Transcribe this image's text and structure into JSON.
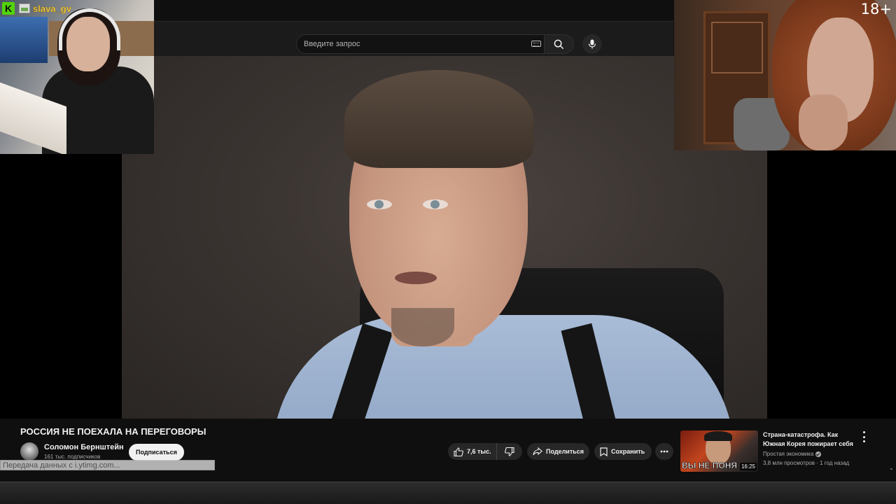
{
  "search": {
    "placeholder": "Введите запрос"
  },
  "video": {
    "title": "РОССИЯ НЕ ПОЕХАЛА НА ПЕРЕГОВОРЫ",
    "channel_name": "Соломон Бернштейн",
    "subscribers": "161 тыс. подписчиков",
    "subscribe_label": "Подписаться",
    "likes": "7,6 тыс.",
    "share_label": "Поделиться",
    "save_label": "Сохранить"
  },
  "status_bar": {
    "text": "Передача данных с i.ytimg.com..."
  },
  "recommendation": {
    "title": "Страна-катастрофа. Как Южная Корея пожирает себя",
    "channel": "Простая экономика",
    "meta": "3,8 млн просмотров · 1 год назад",
    "thumb_text": "ВЫ НЕ ПОНЯ",
    "duration": "16:25"
  },
  "cam_left": {
    "badge": "K",
    "username": "slava_gv"
  },
  "cam_right": {
    "age_label": "18+"
  },
  "icons": {
    "search": "search-icon",
    "mic": "mic-icon",
    "keyboard": "keyboard-icon",
    "like": "thumbs-up-icon",
    "dislike": "thumbs-down-icon",
    "share": "share-icon",
    "save": "save-icon",
    "more": "more-horizontal-icon"
  }
}
